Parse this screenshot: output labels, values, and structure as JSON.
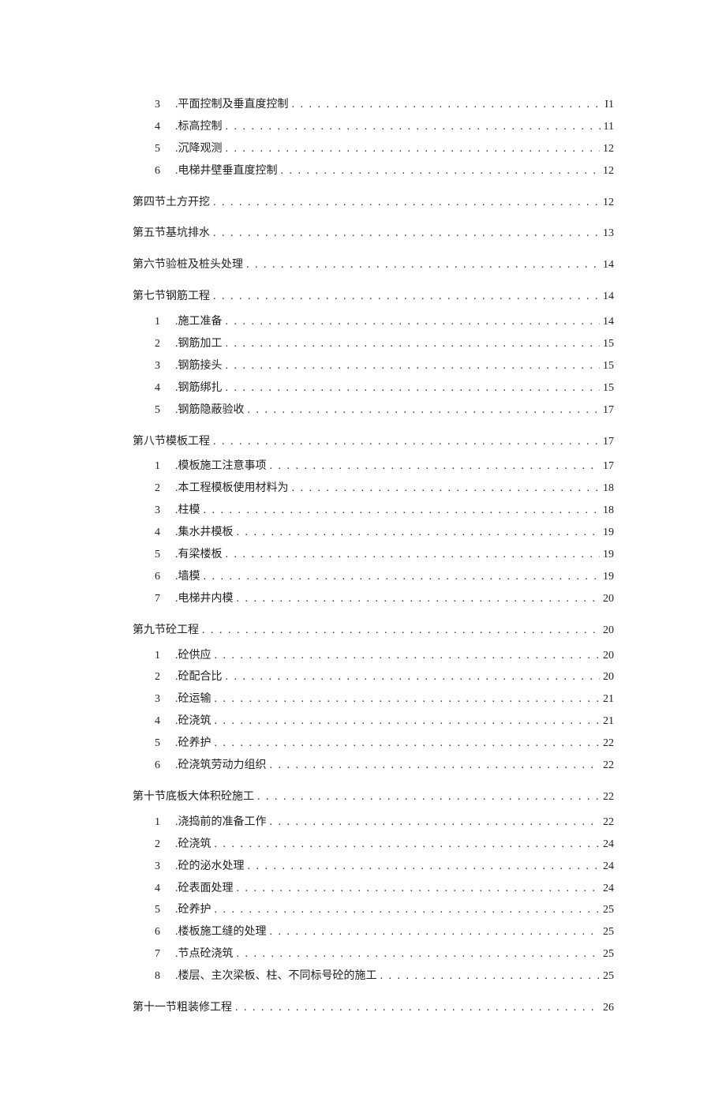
{
  "toc": [
    {
      "type": "sub",
      "num": "3",
      "label": ".平面控制及垂直度控制",
      "page": "I1"
    },
    {
      "type": "sub",
      "num": "4",
      "label": ".标高控制",
      "page": "11"
    },
    {
      "type": "sub",
      "num": "5",
      "label": ".沉降观测",
      "page": "12"
    },
    {
      "type": "sub",
      "num": "6",
      "label": ".电梯井壁垂直度控制",
      "page": "12"
    },
    {
      "type": "section",
      "label": "第四节土方开挖",
      "page": "12"
    },
    {
      "type": "section",
      "label": "第五节基坑排水",
      "page": "13"
    },
    {
      "type": "section",
      "label": "第六节验桩及桩头处理",
      "page": "14"
    },
    {
      "type": "section",
      "label": "第七节钢筋工程",
      "page": "14"
    },
    {
      "type": "sub",
      "num": "1",
      "label": ".施工准备",
      "page": "14"
    },
    {
      "type": "sub",
      "num": "2",
      "label": ".钢筋加工",
      "page": "15"
    },
    {
      "type": "sub",
      "num": "3",
      "label": ".钢筋接头",
      "page": "15"
    },
    {
      "type": "sub",
      "num": "4",
      "label": ".钢筋绑扎",
      "page": "15"
    },
    {
      "type": "sub",
      "num": "5",
      "label": ".钢筋隐蔽验收",
      "page": "17"
    },
    {
      "type": "section",
      "label": "第八节模板工程",
      "page": "17"
    },
    {
      "type": "sub",
      "num": "1",
      "label": ".模板施工注意事项",
      "page": "17"
    },
    {
      "type": "sub",
      "num": "2",
      "label": ".本工程模板使用材料为",
      "page": "18"
    },
    {
      "type": "sub",
      "num": "3",
      "label": ".柱模",
      "page": "18"
    },
    {
      "type": "sub",
      "num": "4",
      "label": ".集水井模板",
      "page": "19"
    },
    {
      "type": "sub",
      "num": "5",
      "label": ".有梁楼板",
      "page": "19"
    },
    {
      "type": "sub",
      "num": "6",
      "label": ".墙模",
      "page": "19"
    },
    {
      "type": "sub",
      "num": "7",
      "label": ".电梯井内模",
      "page": "20"
    },
    {
      "type": "section",
      "label": "第九节砼工程",
      "page": "20"
    },
    {
      "type": "sub",
      "num": "1",
      "label": ".砼供应",
      "page": "20"
    },
    {
      "type": "sub",
      "num": "2",
      "label": ".砼配合比",
      "page": "20"
    },
    {
      "type": "sub",
      "num": "3",
      "label": ".砼运输",
      "page": "21"
    },
    {
      "type": "sub",
      "num": "4",
      "label": ".砼浇筑",
      "page": "21"
    },
    {
      "type": "sub",
      "num": "5",
      "label": ".砼养护",
      "page": "22"
    },
    {
      "type": "sub",
      "num": "6",
      "label": ".砼浇筑劳动力组织",
      "page": "22"
    },
    {
      "type": "section",
      "label": "第十节底板大体积砼施工",
      "page": "22"
    },
    {
      "type": "sub",
      "num": "1",
      "label": ".浇捣前的准备工作",
      "page": "22"
    },
    {
      "type": "sub",
      "num": "2",
      "label": ".砼浇筑",
      "page": "24"
    },
    {
      "type": "sub",
      "num": "3",
      "label": ".砼的泌水处理",
      "page": "24"
    },
    {
      "type": "sub",
      "num": "4",
      "label": ".砼表面处理",
      "page": "24"
    },
    {
      "type": "sub",
      "num": "5",
      "label": ".砼养护",
      "page": "25"
    },
    {
      "type": "sub",
      "num": "6",
      "label": ".楼板施工缝的处理",
      "page": "25"
    },
    {
      "type": "sub",
      "num": "7",
      "label": ".节点砼浇筑",
      "page": "25"
    },
    {
      "type": "sub",
      "num": "8",
      "label": ".楼层、主次梁板、柱、不同标号砼的施工",
      "page": "25"
    },
    {
      "type": "section",
      "label": "第十一节粗装修工程",
      "page": "26"
    }
  ],
  "dots": ". . . . . . . . . . . . . . . . . . . . . . . . . . . . . . . . . . . . . . . . . . . . . . . . . . . . . . . . . . . . . . . . . . . . . . . . . . . . . . . . . . . . . . . . . . . . . . . . . . . ."
}
